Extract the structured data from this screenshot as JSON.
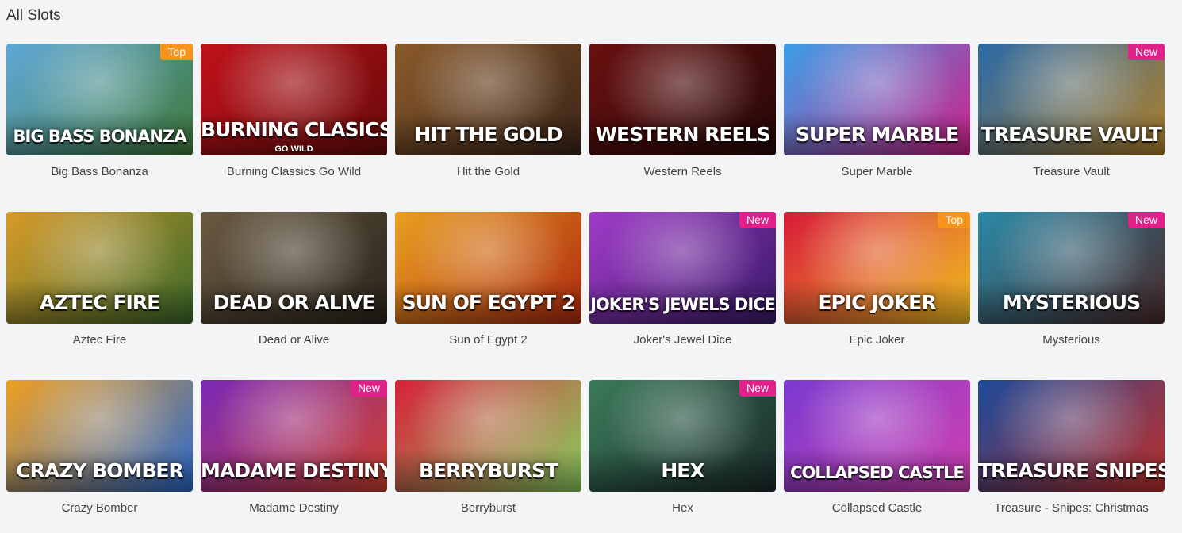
{
  "section": {
    "title": "All Slots"
  },
  "badge_colors": {
    "Top": "#f7941d",
    "New": "#e0218a"
  },
  "games": [
    {
      "name": "Big Bass Bonanza",
      "logo": "BIG BASS BONANZA",
      "badge": "Top",
      "colors": [
        "#5fa8d8",
        "#3f7a3a"
      ]
    },
    {
      "name": "Burning Classics Go Wild",
      "logo": "BURNING CLASICS",
      "logo_sub": "GO WILD",
      "colors": [
        "#c0121a",
        "#6a0a0a"
      ]
    },
    {
      "name": "Hit the Gold",
      "logo": "HIT THE GOLD",
      "colors": [
        "#8a5a2a",
        "#3a2418"
      ]
    },
    {
      "name": "Western Reels",
      "logo": "WESTERN REELS",
      "colors": [
        "#6a1010",
        "#240808"
      ]
    },
    {
      "name": "Super Marble",
      "logo": "SUPER MARBLE",
      "colors": [
        "#3aa0e8",
        "#d0208a"
      ]
    },
    {
      "name": "Treasure Vault",
      "logo": "TREASURE VAULT",
      "badge": "New",
      "colors": [
        "#2a6aa8",
        "#b0802a"
      ]
    },
    {
      "name": "Aztec Fire",
      "logo": "AZTEC FIRE",
      "colors": [
        "#d89a28",
        "#3a6a2a"
      ]
    },
    {
      "name": "Dead or Alive",
      "logo": "DEAD OR ALIVE",
      "colors": [
        "#6a5a42",
        "#2a241c"
      ]
    },
    {
      "name": "Sun of Egypt 2",
      "logo": "SUN OF EGYPT 2",
      "colors": [
        "#e8a020",
        "#b02a10"
      ]
    },
    {
      "name": "Joker's Jewel Dice",
      "logo": "JOKER'S JEWELS DICE",
      "badge": "New",
      "colors": [
        "#a03ac8",
        "#3a1a6a"
      ]
    },
    {
      "name": "Epic Joker",
      "logo": "EPIC JOKER",
      "badge": "Top",
      "colors": [
        "#d81a3a",
        "#f0c020"
      ]
    },
    {
      "name": "Mysterious",
      "logo": "MYSTERIOUS",
      "badge": "New",
      "colors": [
        "#2a8aa8",
        "#4a2a2a"
      ]
    },
    {
      "name": "Crazy Bomber",
      "logo": "CRAZY BOMBER",
      "colors": [
        "#f0a020",
        "#2a6ad0"
      ]
    },
    {
      "name": "Madame Destiny",
      "logo": "MADAME DESTINY",
      "badge": "New",
      "colors": [
        "#7a2ab8",
        "#d0402a"
      ]
    },
    {
      "name": "Berryburst",
      "logo": "BERRYBURST",
      "colors": [
        "#d8203a",
        "#8ad060"
      ]
    },
    {
      "name": "Hex",
      "logo": "HEX",
      "badge": "New",
      "colors": [
        "#3a7a5a",
        "#1a2a2a"
      ]
    },
    {
      "name": "Collapsed Castle",
      "logo": "COLLAPSED CASTLE",
      "colors": [
        "#7a3ad0",
        "#d040b0"
      ]
    },
    {
      "name": "Treasure - Snipes: Christmas",
      "logo": "TREASURE SNIPES",
      "colors": [
        "#1a4a9a",
        "#c0302a"
      ]
    }
  ]
}
